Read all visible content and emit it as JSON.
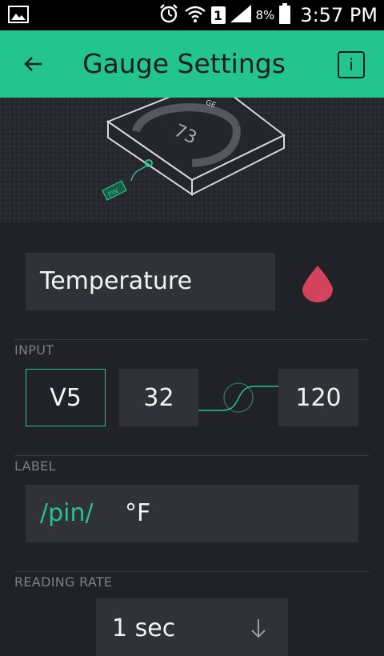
{
  "status_bar": {
    "battery_percent": "8%",
    "time": "3:57 PM",
    "sim_label": "1",
    "icons": [
      "image-icon",
      "alarm-icon",
      "wifi-icon",
      "sim-icon",
      "signal-icon",
      "battery-icon"
    ]
  },
  "header": {
    "title": "Gauge Settings",
    "back_icon": "back-arrow-icon",
    "info_label": "i",
    "color": "#23c48e"
  },
  "hero": {
    "gauge_value": "73",
    "gauge_caption": "GE",
    "pin_tag": "PIN"
  },
  "widget": {
    "name": "Temperature",
    "accent_color": "#d3435c"
  },
  "input": {
    "section_label": "INPUT",
    "pin": "V5",
    "min": "32",
    "max": "120"
  },
  "label": {
    "section_label": "LABEL",
    "pin_token": "/pin/",
    "unit": "°F"
  },
  "reading_rate": {
    "section_label": "READING RATE",
    "value": "1 sec",
    "dropdown_icon": "arrow-down-icon"
  }
}
